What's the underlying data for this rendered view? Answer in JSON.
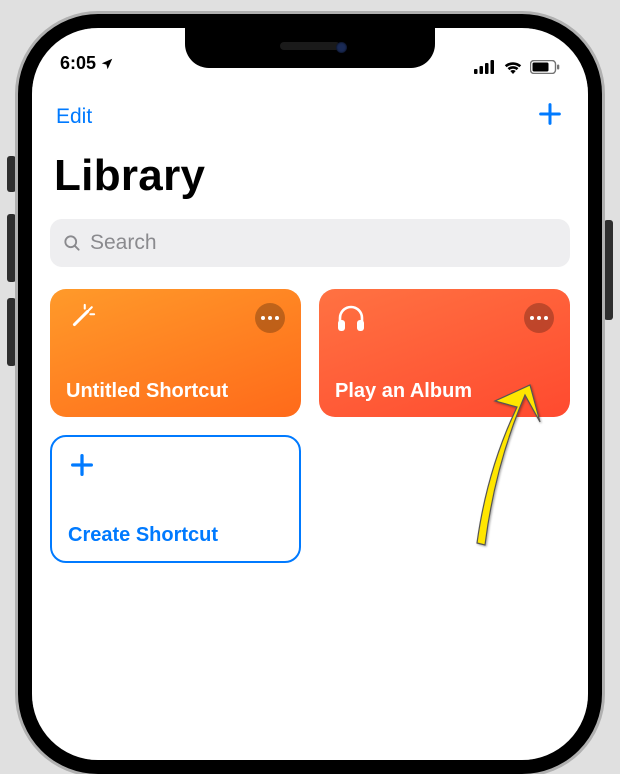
{
  "statusbar": {
    "time": "6:05"
  },
  "navbar": {
    "edit_label": "Edit"
  },
  "page": {
    "title": "Library"
  },
  "search": {
    "placeholder": "Search"
  },
  "cards": {
    "untitled": {
      "label": "Untitled Shortcut"
    },
    "play_album": {
      "label": "Play an Album"
    },
    "create": {
      "label": "Create Shortcut"
    }
  }
}
